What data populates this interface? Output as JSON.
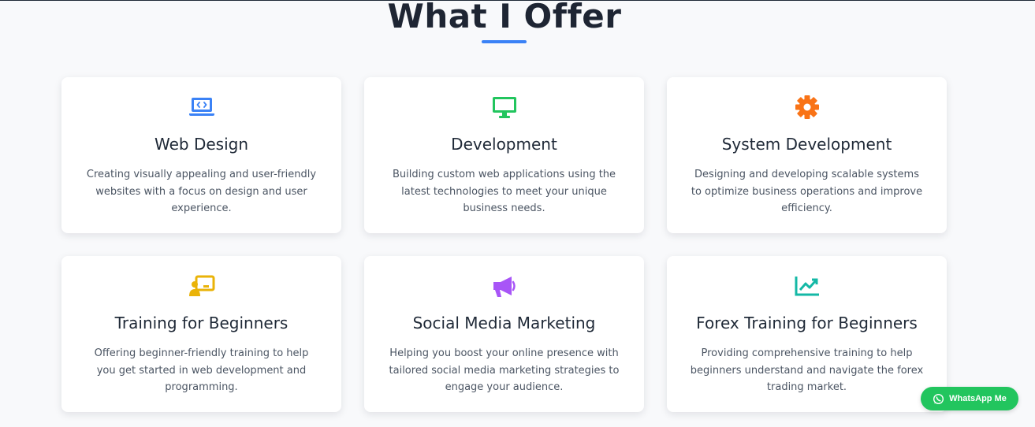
{
  "section": {
    "title": "What I Offer",
    "accent_color": "#3b82f6"
  },
  "services": [
    {
      "title": "Web Design",
      "description": "Creating visually appealing and user-friendly websites with a focus on design and user experience.",
      "icon": "laptop-code-icon",
      "icon_color": "#3b82f6"
    },
    {
      "title": "Development",
      "description": "Building custom web applications using the latest technologies to meet your unique business needs.",
      "icon": "desktop-monitor-icon",
      "icon_color": "#22c55e"
    },
    {
      "title": "System Development",
      "description": "Designing and developing scalable systems to optimize business operations and improve efficiency.",
      "icon": "gear-icon",
      "icon_color": "#f97316"
    },
    {
      "title": "Training for Beginners",
      "description": "Offering beginner-friendly training to help you get started in web development and programming.",
      "icon": "chalkboard-teacher-icon",
      "icon_color": "#eab308"
    },
    {
      "title": "Social Media Marketing",
      "description": "Helping you boost your online presence with tailored social media marketing strategies to engage your audience.",
      "icon": "bullhorn-icon",
      "icon_color": "#a855f7"
    },
    {
      "title": "Forex Training for Beginners",
      "description": "Providing comprehensive training to help beginners understand and navigate the forex trading market.",
      "icon": "chart-line-icon",
      "icon_color": "#14b8a6"
    }
  ],
  "whatsapp": {
    "label": "WhatsApp Me",
    "icon": "whatsapp-icon",
    "color": "#22c55e"
  }
}
